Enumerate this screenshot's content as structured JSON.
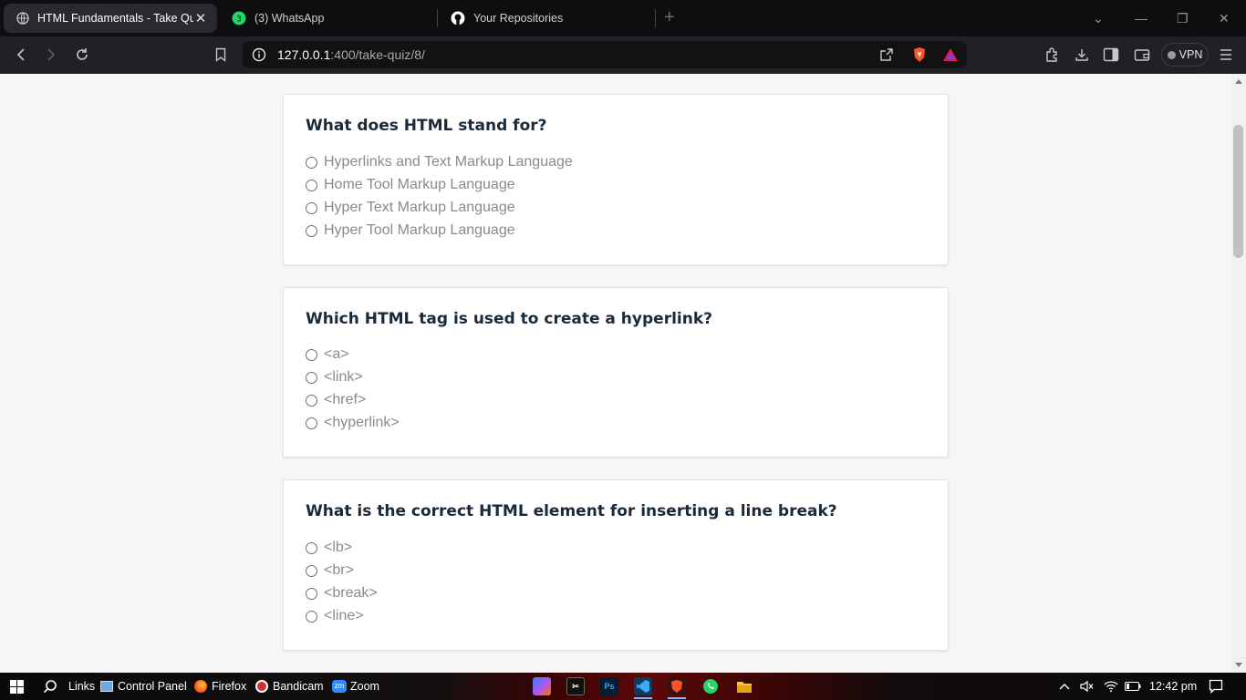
{
  "browser": {
    "tabs": [
      {
        "title": "HTML Fundamentals - Take Quiz",
        "icon": "globe-icon",
        "active": true
      },
      {
        "title": "(3) WhatsApp",
        "icon": "whatsapp-icon",
        "badge": "3",
        "active": false
      },
      {
        "title": "Your Repositories",
        "icon": "github-icon",
        "active": false
      }
    ],
    "url": {
      "host": "127.0.0.1",
      "path": ":400/take-quiz/8/"
    },
    "vpn_label": "VPN"
  },
  "quiz": {
    "questions": [
      {
        "title": "What does HTML stand for?",
        "options": [
          "Hyperlinks and Text Markup Language",
          "Home Tool Markup Language",
          "Hyper Text Markup Language",
          "Hyper Tool Markup Language"
        ]
      },
      {
        "title": "Which HTML tag is used to create a hyperlink?",
        "options": [
          "<a>",
          "<link>",
          "<href>",
          "<hyperlink>"
        ]
      },
      {
        "title": "What is the correct HTML element for inserting a line break?",
        "options": [
          "<lb>",
          "<br>",
          "<break>",
          "<line>"
        ]
      }
    ]
  },
  "taskbar": {
    "items": [
      "Links",
      "Control Panel",
      "Firefox",
      "Bandicam",
      "Zoom"
    ],
    "apps": [
      "copilot-icon",
      "capcut-icon",
      "photoshop-icon",
      "vscode-icon",
      "brave-icon",
      "whatsapp-icon",
      "file-explorer-icon"
    ],
    "photoshop_label": "Ps",
    "zoom_label": "zm",
    "time": "12:42 pm"
  },
  "colors": {
    "page_bg": "#f6f6f6",
    "card_bg": "#ffffff",
    "question_text": "#1b2a3a",
    "option_text": "#8a8a8a",
    "tabstrip_bg": "#0e0e10",
    "toolbar_bg": "#202124"
  }
}
